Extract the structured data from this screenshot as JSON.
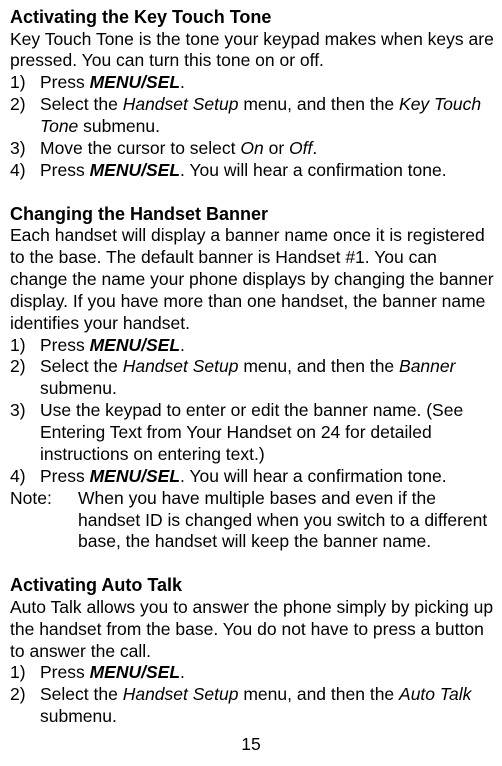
{
  "section1": {
    "heading": "Activating the Key Touch Tone",
    "intro": "Key Touch Tone is the tone your keypad makes when keys are pressed. You can turn this tone on or off.",
    "steps": {
      "s1_pre": "Press ",
      "s1_bold": "MENU/SEL",
      "s1_post": ".",
      "s2_pre": "Select the ",
      "s2_it1": "Handset Setup",
      "s2_mid": " menu, and then the ",
      "s2_it2": "Key Touch Tone",
      "s2_post": " submenu.",
      "s3_pre": "Move the cursor to select ",
      "s3_it1": "On",
      "s3_mid": " or ",
      "s3_it2": "Off",
      "s3_post": ".",
      "s4_pre": "Press ",
      "s4_bold": "MENU/SEL",
      "s4_post": ". You will hear a confirmation tone."
    }
  },
  "section2": {
    "heading": "Changing the Handset Banner",
    "intro": "Each handset will display a banner name once it is registered to the base. The default banner is Handset #1. You can change the name your phone displays by changing the banner display. If you have more than one handset, the banner name identifies your handset.",
    "steps": {
      "s1_pre": "Press ",
      "s1_bold": "MENU/SEL",
      "s1_post": ".",
      "s2_pre": "Select the ",
      "s2_it1": "Handset Setup",
      "s2_mid": " menu, and then the ",
      "s2_it2": "Banner",
      "s2_post": "submenu.",
      "s3": "Use the keypad to enter or edit the banner name. (See Entering Text from Your Handset on 24 for detailed instructions on entering text.)",
      "s4_pre": "Press ",
      "s4_bold": "MENU/SEL",
      "s4_post": ". You will hear a confirmation tone."
    },
    "note_label": "Note:",
    "note_text": "When you have multiple bases and even if the handset ID is changed when you switch to a different base, the handset will keep the banner name."
  },
  "section3": {
    "heading": "Activating Auto Talk",
    "intro": "Auto Talk allows you to answer the phone simply by picking up the handset from the base. You do not have to press a button to answer the call.",
    "steps": {
      "s1_pre": "Press ",
      "s1_bold": "MENU/SEL",
      "s1_post": ".",
      "s2_pre": "Select the ",
      "s2_it1": "Handset Setup",
      "s2_mid": " menu, and then the ",
      "s2_it2": "Auto Talk",
      "s2_post": "submenu."
    }
  },
  "page_number": "15",
  "nums": {
    "n1": "1)",
    "n2": "2)",
    "n3": "3)",
    "n4": "4)"
  }
}
